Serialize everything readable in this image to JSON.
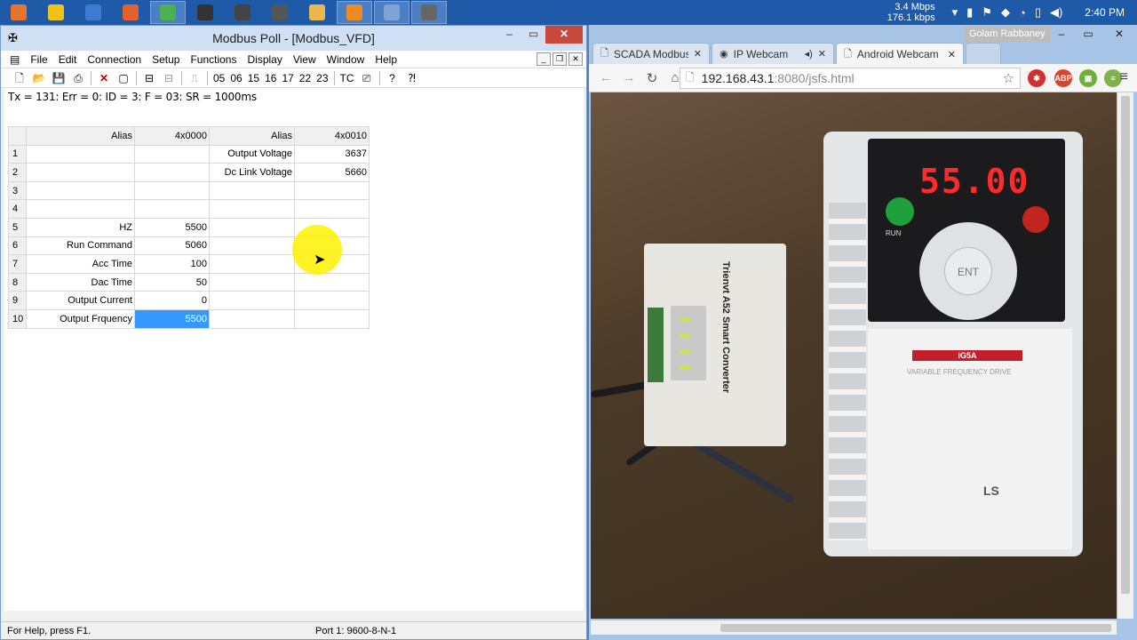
{
  "taskbar": {
    "items": [
      {
        "icon": "office-icon",
        "color": "#e8732c"
      },
      {
        "icon": "maps-icon",
        "color": "#f2c21c"
      },
      {
        "icon": "control-panel-icon",
        "color": "#3b7bd1"
      },
      {
        "icon": "firefox-icon",
        "color": "#e5612b"
      },
      {
        "icon": "chrome-icon",
        "color": "#4caf50",
        "active": true
      },
      {
        "icon": "terminal-icon",
        "color": "#333333"
      },
      {
        "icon": "tool-icon",
        "color": "#444444"
      },
      {
        "icon": "window-icon",
        "color": "#555555"
      },
      {
        "icon": "folder-icon",
        "color": "#e8b84a"
      },
      {
        "icon": "app-g-icon",
        "color": "#f08a24",
        "active": true
      },
      {
        "icon": "calculator-icon",
        "color": "#7fa3d6",
        "active": true
      },
      {
        "icon": "modbus-icon",
        "color": "#666666",
        "active": true
      }
    ],
    "net_up": "3.4 Mbps",
    "net_down": "176.1 kbps",
    "clock": "2:40 PM"
  },
  "modbus": {
    "title": "Modbus Poll - [Modbus_VFD]",
    "menu": [
      "File",
      "Edit",
      "Connection",
      "Setup",
      "Functions",
      "Display",
      "View",
      "Window",
      "Help"
    ],
    "toolbar_codes": [
      "05",
      "06",
      "15",
      "16",
      "17",
      "22",
      "23"
    ],
    "toolbar_tc": "TC",
    "status_line": "Tx = 131: Err = 0: ID = 3: F = 03: SR = 1000ms",
    "columns": [
      "Alias",
      "4x0000",
      "Alias",
      "4x0010"
    ],
    "rows": [
      {
        "n": "1",
        "a1": "",
        "v1": "",
        "a2": "Output Voltage",
        "v2": "3637"
      },
      {
        "n": "2",
        "a1": "",
        "v1": "",
        "a2": "Dc Link Voltage",
        "v2": "5660"
      },
      {
        "n": "3",
        "a1": "",
        "v1": "",
        "a2": "",
        "v2": ""
      },
      {
        "n": "4",
        "a1": "",
        "v1": "",
        "a2": "",
        "v2": ""
      },
      {
        "n": "5",
        "a1": "HZ",
        "v1": "5500",
        "a2": "",
        "v2": ""
      },
      {
        "n": "6",
        "a1": "Run Command",
        "v1": "5060",
        "a2": "",
        "v2": ""
      },
      {
        "n": "7",
        "a1": "Acc Time",
        "v1": "100",
        "a2": "",
        "v2": ""
      },
      {
        "n": "8",
        "a1": "Dac Time",
        "v1": "50",
        "a2": "",
        "v2": ""
      },
      {
        "n": "9",
        "a1": "Output Current",
        "v1": "0",
        "a2": "",
        "v2": ""
      },
      {
        "n": "10",
        "a1": "Output Frquency",
        "v1": "5500",
        "a2": "",
        "v2": ""
      }
    ],
    "statusbar_help": "For Help, press F1.",
    "statusbar_port": "Port 1: 9600-8-N-1"
  },
  "browser": {
    "profile": "Golam Rabbaney",
    "tabs": [
      {
        "label": "SCADA Modbus R",
        "icon": "page-icon"
      },
      {
        "label": "IP Webcam",
        "icon": "camera-icon"
      },
      {
        "label": "Android Webcam",
        "icon": "page-icon",
        "active": true
      }
    ],
    "url_host": "192.168.43.1",
    "url_path": ":8080/jsfs.html",
    "extensions": [
      {
        "name": "lastpass-icon",
        "label": "✱",
        "color": "#d32f2f"
      },
      {
        "name": "adblock-icon",
        "label": "ABP",
        "color": "#d9442e"
      },
      {
        "name": "android-icon",
        "label": "▣",
        "color": "#6fae3a"
      },
      {
        "name": "evernote-icon",
        "label": "≡",
        "color": "#7fb24a"
      }
    ]
  },
  "webcam": {
    "display_value": "55.00",
    "run_label": "RUN",
    "ent_label": "ENT",
    "model": "iG5A",
    "sublabel": "VARIABLE FREQUENCY DRIVE",
    "brand": "LS",
    "converter_label": "Trienvt A52 Smart Converter"
  }
}
